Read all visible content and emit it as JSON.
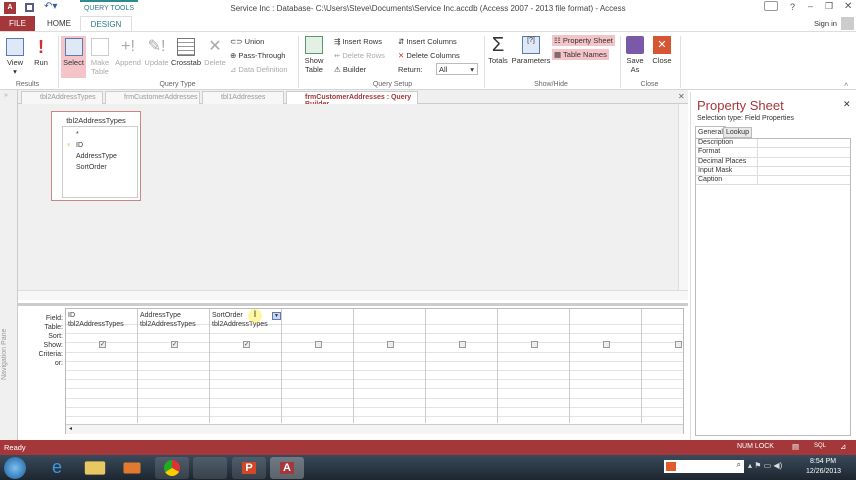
{
  "window": {
    "title": "Service Inc : Database- C:\\Users\\Steve\\Documents\\Service Inc.accdb (Access 2007 - 2013 file format) - Access",
    "context_tab": "QUERY TOOLS",
    "sign_in": "Sign in",
    "help": "?"
  },
  "tabs": {
    "file": "FILE",
    "home": "HOME",
    "design": "DESIGN"
  },
  "ribbon": {
    "results": {
      "label": "Results",
      "view": "View",
      "run": "Run"
    },
    "query_type": {
      "label": "Query Type",
      "select": "Select",
      "make_table": "Make Table",
      "append": "Append",
      "update": "Update",
      "crosstab": "Crosstab",
      "delete": "Delete",
      "union": "Union",
      "pass_through": "Pass-Through",
      "data_definition": "Data Definition"
    },
    "query_setup": {
      "label": "Query Setup",
      "show_table": "Show Table",
      "insert_rows": "Insert Rows",
      "delete_rows": "Delete Rows",
      "builder": "Builder",
      "insert_columns": "Insert Columns",
      "delete_columns": "Delete Columns",
      "return_label": "Return:",
      "return_value": "All"
    },
    "show_hide": {
      "label": "Show/Hide",
      "totals": "Totals",
      "parameters": "Parameters",
      "property_sheet": "Property Sheet",
      "table_names": "Table Names"
    },
    "close": {
      "label": "Close",
      "save_as": "Save As",
      "close": "Close"
    }
  },
  "doc_tabs": [
    "tbl2AddressTypes",
    "frmCustomerAddresses",
    "tbl1Addresses",
    "frmCustomerAddresses : Query Builder"
  ],
  "nav_pane": "Navigation Pane",
  "table_box": {
    "title": "tbl2AddressTypes",
    "fields": [
      "*",
      "ID",
      "AddressType",
      "SortOrder"
    ]
  },
  "grid": {
    "row_labels": [
      "Field:",
      "Table:",
      "Sort:",
      "Show:",
      "Criteria:",
      "or:"
    ],
    "columns": [
      {
        "field": "ID",
        "table": "tbl2AddressTypes",
        "show": true
      },
      {
        "field": "AddressType",
        "table": "tbl2AddressTypes",
        "show": true
      },
      {
        "field": "SortOrder",
        "table": "tbl2AddressTypes",
        "show": true
      },
      {
        "field": "",
        "table": "",
        "show": false
      },
      {
        "field": "",
        "table": "",
        "show": false
      },
      {
        "field": "",
        "table": "",
        "show": false
      },
      {
        "field": "",
        "table": "",
        "show": false
      },
      {
        "field": "",
        "table": "",
        "show": false
      },
      {
        "field": "",
        "table": "",
        "show": false
      }
    ]
  },
  "property_sheet": {
    "title": "Property Sheet",
    "selection_type": "Selection type:  Field Properties",
    "tabs": [
      "General",
      "Lookup"
    ],
    "properties": [
      "Description",
      "Format",
      "Decimal Places",
      "Input Mask",
      "Caption"
    ]
  },
  "status": {
    "left": "Ready",
    "num_lock": "NUM LOCK"
  },
  "taskbar": {
    "time": "8:54 PM",
    "date": "12/26/2013"
  },
  "colors": {
    "accent": "#a4373a",
    "teal": "#2e7b8b"
  }
}
